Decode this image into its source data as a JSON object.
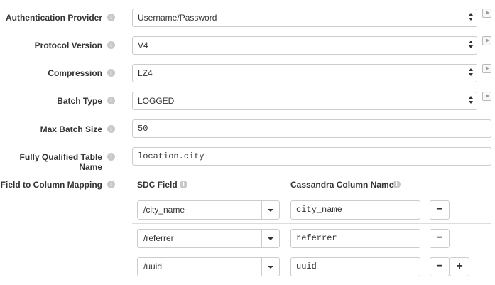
{
  "fields": {
    "auth_provider": {
      "label": "Authentication Provider",
      "value": "Username/Password"
    },
    "protocol_version": {
      "label": "Protocol Version",
      "value": "V4"
    },
    "compression": {
      "label": "Compression",
      "value": "LZ4"
    },
    "batch_type": {
      "label": "Batch Type",
      "value": "LOGGED"
    },
    "max_batch_size": {
      "label": "Max Batch Size",
      "value": "50"
    },
    "table_name": {
      "label": "Fully Qualified Table Name",
      "value": "location.city"
    }
  },
  "mapping": {
    "label": "Field to Column Mapping",
    "sdc_field_header": "SDC Field",
    "column_header": "Cassandra Column Name",
    "remove_label": "−",
    "add_label": "+",
    "rows": [
      {
        "field": "/city_name",
        "column": "city_name"
      },
      {
        "field": "/referrer",
        "column": "referrer"
      },
      {
        "field": "/uuid",
        "column": "uuid"
      }
    ]
  },
  "icons": {
    "info": "info-icon",
    "play": "play-icon",
    "caret": "chevron-down-icon",
    "select_arrows": "select-arrows-icon"
  }
}
